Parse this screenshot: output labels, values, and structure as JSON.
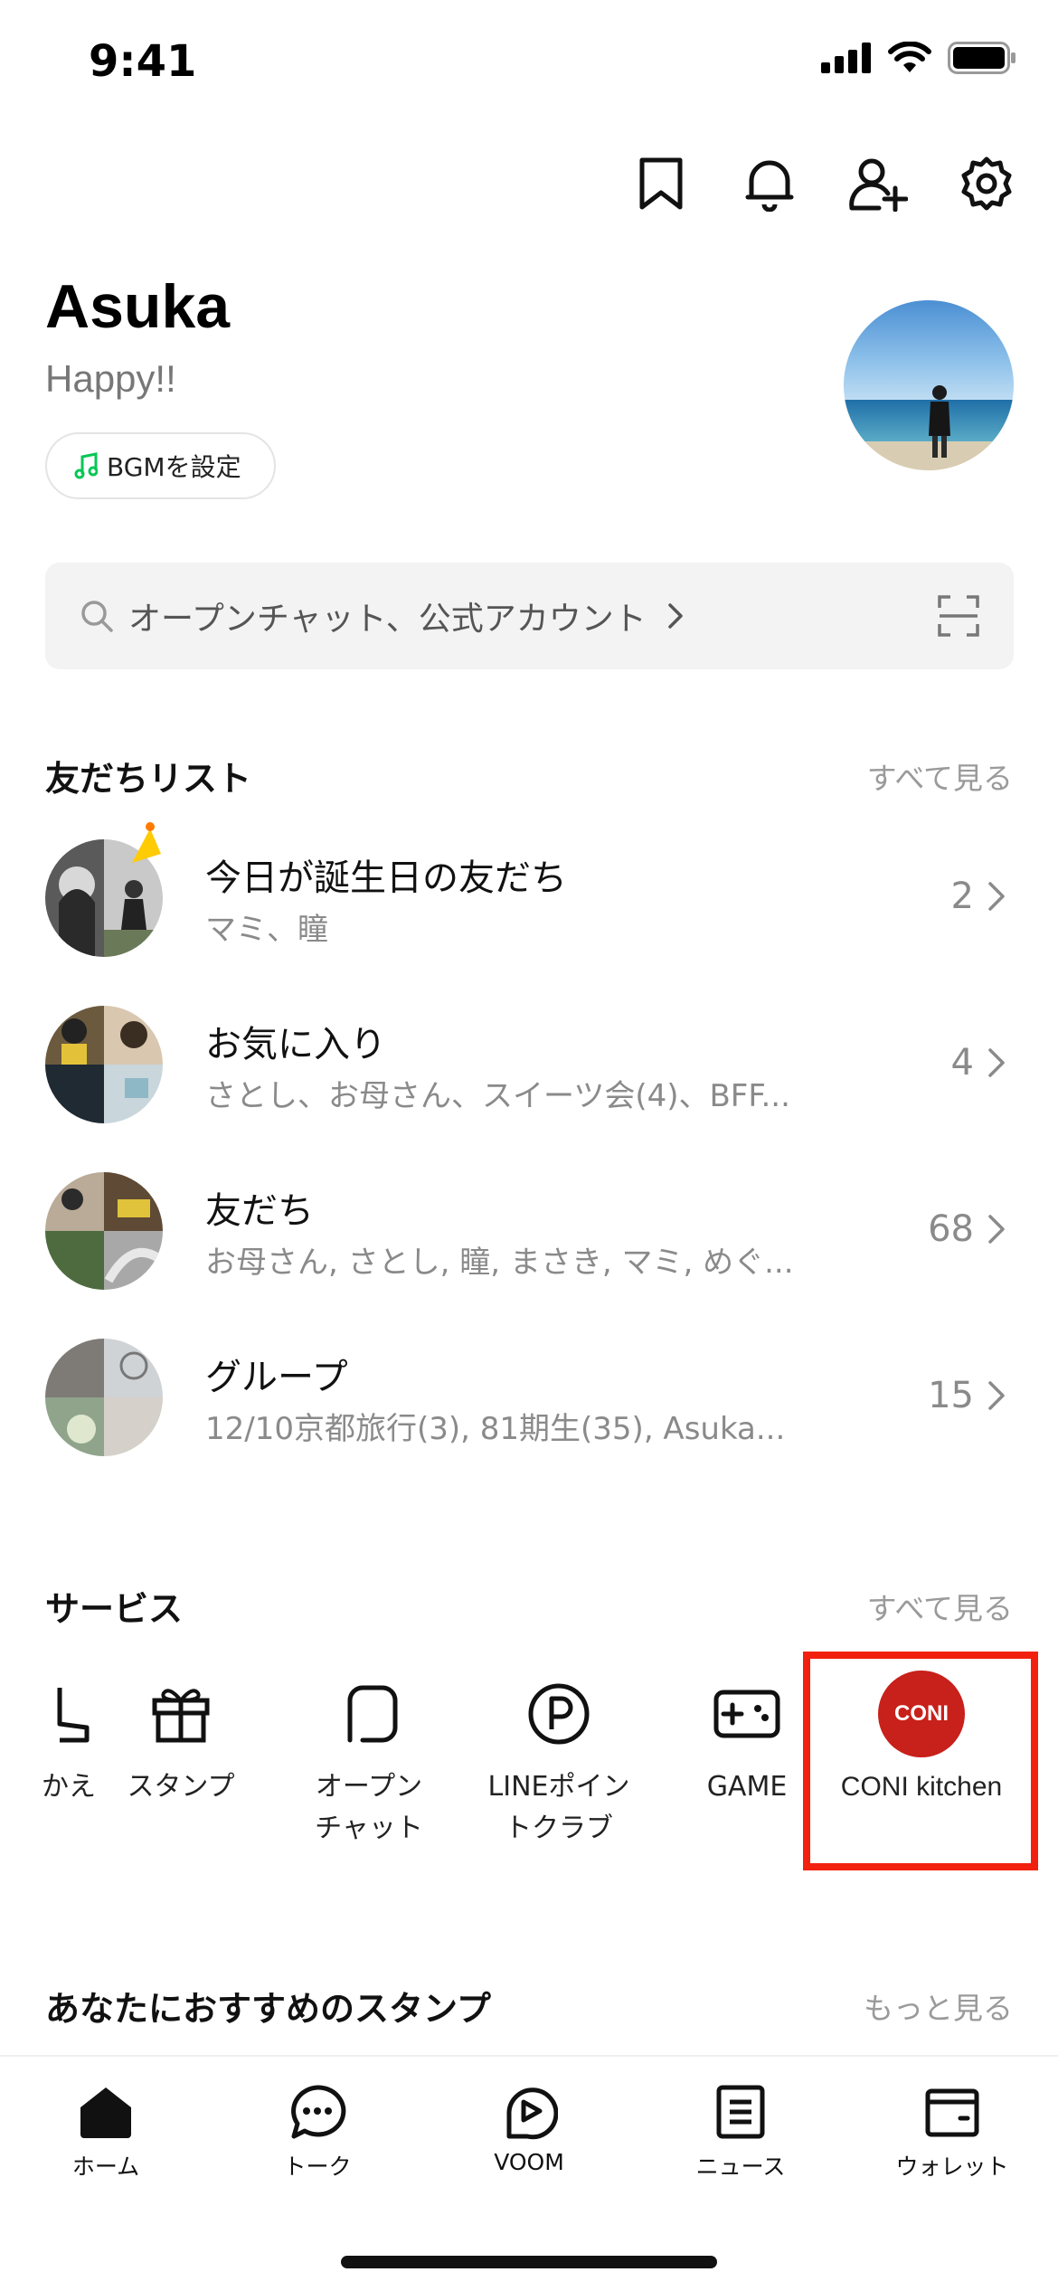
{
  "status_bar": {
    "time": "9:41"
  },
  "top_actions": {
    "icons": [
      "bookmark-icon",
      "bell-icon",
      "add-friend-icon",
      "settings-icon"
    ]
  },
  "profile": {
    "name": "Asuka",
    "status_message": "Happy!!",
    "bgm_label": "BGMを設定"
  },
  "search": {
    "placeholder": "オープンチャット、公式アカウント"
  },
  "friends_section": {
    "title": "友だちリスト",
    "see_all": "すべて見る",
    "rows": [
      {
        "title": "今日が誕生日の友だち",
        "subtitle": "マミ、瞳",
        "count": "2"
      },
      {
        "title": "お気に入り",
        "subtitle": "さとし、お母さん、スイーツ会(4)、BFF...",
        "count": "4"
      },
      {
        "title": "友だち",
        "subtitle": "お母さん, さとし, 瞳,  まさき, マミ,  めぐ...",
        "count": "68"
      },
      {
        "title": "グループ",
        "subtitle": "12/10京都旅行(3), 81期生(35), Asuka...",
        "count": "15"
      }
    ]
  },
  "services_section": {
    "title": "サービス",
    "see_all": "すべて見る",
    "items": [
      {
        "label": "かえ",
        "icon": "theme-icon"
      },
      {
        "label": "スタンプ",
        "icon": "gift-icon"
      },
      {
        "label": "オープン\nチャット",
        "icon": "open-chat-icon"
      },
      {
        "label": "LINEポイン\nトクラブ",
        "icon": "points-icon"
      },
      {
        "label": "GAME",
        "icon": "game-icon"
      },
      {
        "label": "CONI kitchen",
        "icon": "coni-logo",
        "badge_text": "CONI"
      }
    ]
  },
  "stickers_section": {
    "title": "あなたにおすすめのスタンプ",
    "see_more": "もっと見る"
  },
  "bottom_nav": {
    "items": [
      {
        "label": "ホーム",
        "icon": "home-icon"
      },
      {
        "label": "トーク",
        "icon": "chat-icon"
      },
      {
        "label": "VOOM",
        "icon": "voom-icon"
      },
      {
        "label": "ニュース",
        "icon": "news-icon"
      },
      {
        "label": "ウォレット",
        "icon": "wallet-icon"
      }
    ]
  },
  "colors": {
    "accent_green": "#06c755",
    "highlight_red": "#f2200f",
    "coni_red": "#c8201a"
  }
}
